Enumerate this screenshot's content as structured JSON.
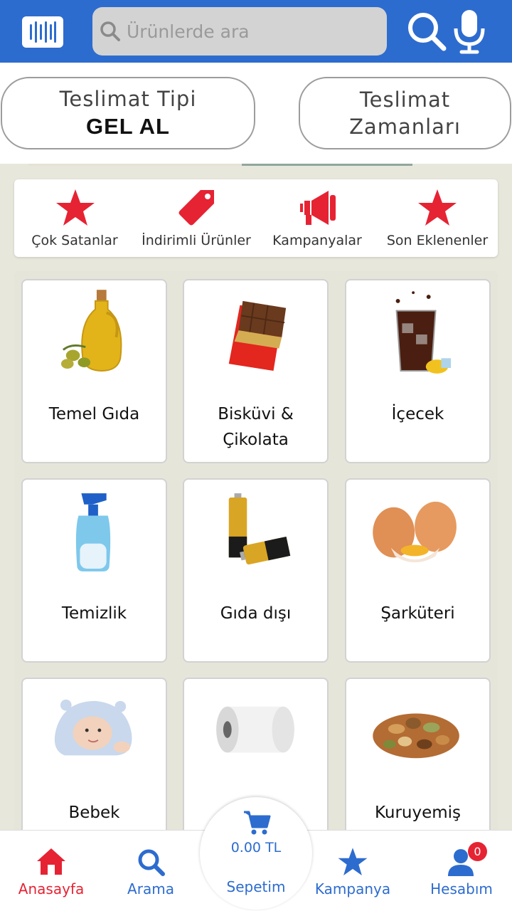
{
  "search": {
    "placeholder": "Ürünlerde ara"
  },
  "delivery": {
    "type_label": "Teslimat Tipi",
    "type_value": "GEL AL",
    "time_label_1": "Teslimat",
    "time_label_2": "Zamanları"
  },
  "quick_links": [
    {
      "label": "Çok Satanlar",
      "icon": "star-icon"
    },
    {
      "label": "İndirimli Ürünler",
      "icon": "price-tag-icon"
    },
    {
      "label": "Kampanyalar",
      "icon": "megaphone-icon"
    },
    {
      "label": "Son Eklenenler",
      "icon": "star-icon"
    }
  ],
  "categories": [
    {
      "label": "Temel Gıda",
      "image": "olive-oil-bottle"
    },
    {
      "label": "Bisküvi & Çikolata",
      "image": "chocolate-bar"
    },
    {
      "label": "İçecek",
      "image": "cola-glass"
    },
    {
      "label": "Temizlik",
      "image": "spray-bottle"
    },
    {
      "label": "Gıda dışı",
      "image": "batteries"
    },
    {
      "label": "Şarküteri",
      "image": "eggs"
    },
    {
      "label": "Bebek",
      "image": "baby-in-towel"
    },
    {
      "label": "",
      "image": "paper-towel-roll"
    },
    {
      "label": "Kuruyemiş",
      "image": "mixed-nuts"
    }
  ],
  "bottom_nav": {
    "home": "Anasayfa",
    "search": "Arama",
    "cart_total": "0.00 TL",
    "cart": "Sepetim",
    "campaign": "Kampanya",
    "account": "Hesabım",
    "account_badge": "0"
  },
  "colors": {
    "primary": "#2d6ccf",
    "accent_red": "#e62333",
    "background": "#e8e7dc"
  }
}
